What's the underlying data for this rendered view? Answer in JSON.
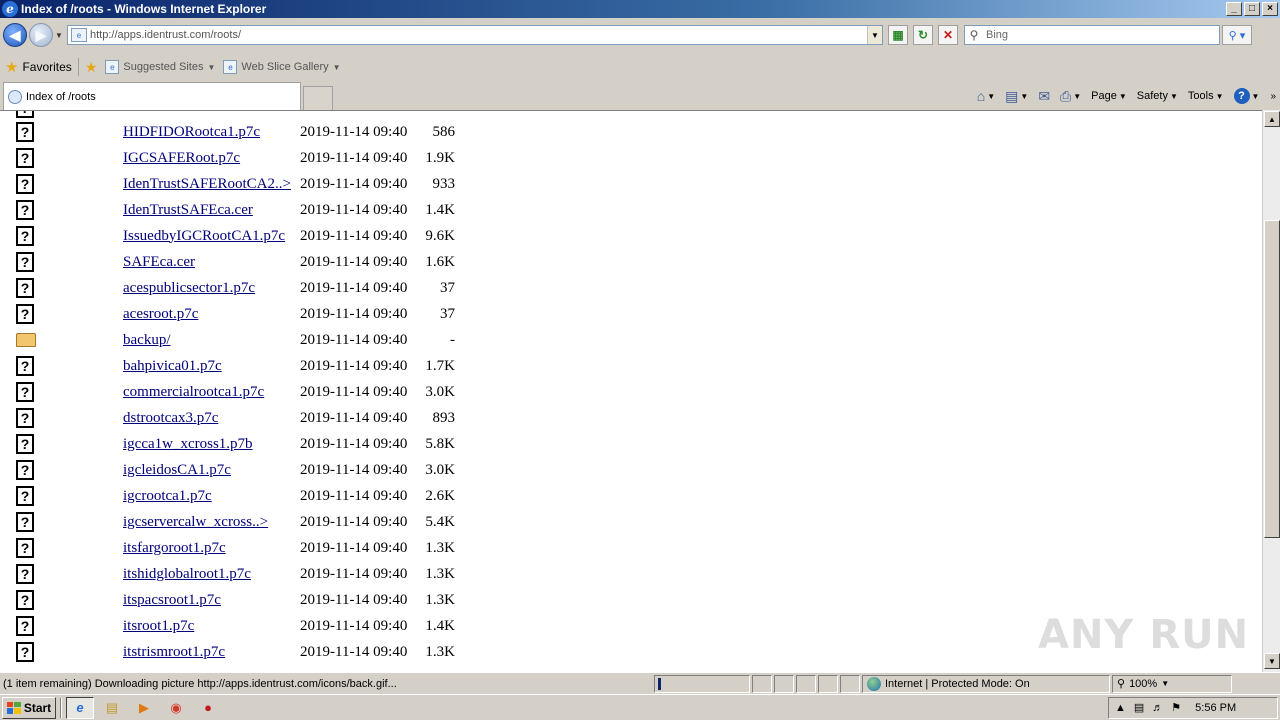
{
  "window": {
    "title": "Index of /roots - Windows Internet Explorer",
    "buttons": [
      "_",
      "□",
      "×"
    ]
  },
  "address_bar": {
    "url": "http://apps.identrust.com/roots/",
    "search_placeholder": "Bing"
  },
  "favorites_bar": {
    "favorites_label": "Favorites",
    "links": [
      "Suggested Sites",
      "Web Slice Gallery"
    ]
  },
  "tab": {
    "title": "Index of /roots"
  },
  "command_bar": {
    "items": [
      "Page",
      "Safety",
      "Tools"
    ]
  },
  "files": [
    {
      "name": "HIDFIDORootca1.p7c",
      "date": "2019-11-14 09:40",
      "size": "586",
      "type": "file"
    },
    {
      "name": "IGCSAFERoot.p7c",
      "date": "2019-11-14 09:40",
      "size": "1.9K",
      "type": "file"
    },
    {
      "name": "IdenTrustSAFERootCA2..>",
      "date": "2019-11-14 09:40",
      "size": "933",
      "type": "file"
    },
    {
      "name": "IdenTrustSAFEca.cer",
      "date": "2019-11-14 09:40",
      "size": "1.4K",
      "type": "file"
    },
    {
      "name": "IssuedbyIGCRootCA1.p7c",
      "date": "2019-11-14 09:40",
      "size": "9.6K",
      "type": "file"
    },
    {
      "name": "SAFEca.cer",
      "date": "2019-11-14 09:40",
      "size": "1.6K",
      "type": "file"
    },
    {
      "name": "acespublicsector1.p7c",
      "date": "2019-11-14 09:40",
      "size": "37",
      "type": "file"
    },
    {
      "name": "acesroot.p7c",
      "date": "2019-11-14 09:40",
      "size": "37",
      "type": "file"
    },
    {
      "name": "backup/",
      "date": "2019-11-14 09:40",
      "size": "-",
      "type": "folder"
    },
    {
      "name": "bahpivica01.p7c",
      "date": "2019-11-14 09:40",
      "size": "1.7K",
      "type": "file"
    },
    {
      "name": "commercialrootca1.p7c",
      "date": "2019-11-14 09:40",
      "size": "3.0K",
      "type": "file"
    },
    {
      "name": "dstrootcax3.p7c",
      "date": "2019-11-14 09:40",
      "size": "893",
      "type": "file"
    },
    {
      "name": "igcca1w_xcross1.p7b",
      "date": "2019-11-14 09:40",
      "size": "5.8K",
      "type": "file"
    },
    {
      "name": "igcleidosCA1.p7c",
      "date": "2019-11-14 09:40",
      "size": "3.0K",
      "type": "file"
    },
    {
      "name": "igcrootca1.p7c",
      "date": "2019-11-14 09:40",
      "size": "2.6K",
      "type": "file"
    },
    {
      "name": "igcservercalw_xcross..>",
      "date": "2019-11-14 09:40",
      "size": "5.4K",
      "type": "file"
    },
    {
      "name": "itsfargoroot1.p7c",
      "date": "2019-11-14 09:40",
      "size": "1.3K",
      "type": "file"
    },
    {
      "name": "itshidglobalroot1.p7c",
      "date": "2019-11-14 09:40",
      "size": "1.3K",
      "type": "file"
    },
    {
      "name": "itspacsroot1.p7c",
      "date": "2019-11-14 09:40",
      "size": "1.3K",
      "type": "file"
    },
    {
      "name": "itsroot1.p7c",
      "date": "2019-11-14 09:40",
      "size": "1.4K",
      "type": "file"
    },
    {
      "name": "itstrismroot1.p7c",
      "date": "2019-11-14 09:40",
      "size": "1.3K",
      "type": "file"
    }
  ],
  "status_bar": {
    "text": "(1 item remaining) Downloading picture http://apps.identrust.com/icons/back.gif...",
    "zone": "Internet | Protected Mode: On",
    "zoom": "100%"
  },
  "taskbar": {
    "start_label": "Start",
    "clock": "5:56 PM"
  },
  "watermark": "ANY RUN"
}
